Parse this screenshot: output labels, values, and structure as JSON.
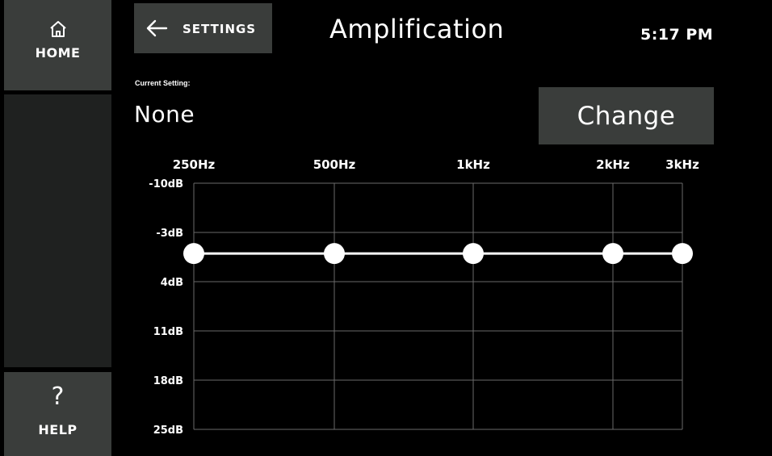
{
  "sidebar": {
    "home_label": "HOME",
    "help_label": "HELP",
    "help_glyph": "?",
    "home_icon": "home-icon",
    "help_icon": "question-icon"
  },
  "header": {
    "back_label": "SETTINGS",
    "back_icon": "arrow-left-icon",
    "title": "Amplification",
    "time": "5:17 PM"
  },
  "current_setting": {
    "label": "Current Setting:",
    "value": "None",
    "change_label": "Change"
  },
  "chart_data": {
    "type": "line",
    "categories": [
      "250Hz",
      "500Hz",
      "1kHz",
      "2kHz",
      "3kHz"
    ],
    "y_ticks": [
      "-10dB",
      "-3dB",
      "4dB",
      "11dB",
      "18dB",
      "25dB"
    ],
    "y_values": [
      -10,
      -3,
      4,
      11,
      18,
      25
    ],
    "ylim": [
      -10,
      25
    ],
    "y_inverted": true,
    "series": [
      {
        "values": [
          0,
          0,
          0,
          0,
          0
        ]
      }
    ],
    "grid": true,
    "colors": {
      "line": "#ffffff",
      "grid": "#6a6a6a",
      "point": "#ffffff"
    }
  }
}
